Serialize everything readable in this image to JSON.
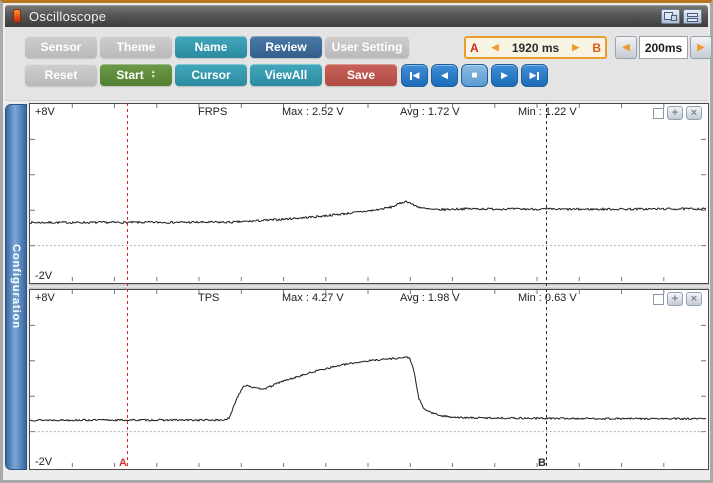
{
  "titlebar": {
    "title": "Oscilloscope",
    "app_icon": "thermometer-icon",
    "right_icons": [
      "tile-windows-icon",
      "stack-windows-icon"
    ]
  },
  "toolbar": {
    "row1": [
      {
        "label": "Sensor",
        "variant": "gray"
      },
      {
        "label": "Theme",
        "variant": "gray"
      },
      {
        "label": "Name",
        "variant": "teal"
      },
      {
        "label": "Review",
        "variant": "blue"
      },
      {
        "label": "User Setting",
        "variant": "gray"
      }
    ],
    "row2": [
      {
        "label": "Reset",
        "variant": "gray"
      },
      {
        "label": "Start",
        "variant": "green",
        "spinner_up": "▲",
        "spinner_down": "▼"
      },
      {
        "label": "Cursor",
        "variant": "teal"
      },
      {
        "label": "ViewAll",
        "variant": "teal"
      },
      {
        "label": "Save",
        "variant": "red"
      }
    ],
    "ab_box": {
      "a_label": "A",
      "left_arrow": "◀",
      "value": "1920 ms",
      "right_arrow": "▶",
      "b_label": "B"
    },
    "interval": {
      "left_arrow": "◀",
      "value": "200ms",
      "right_arrow": "▶"
    },
    "playback": {
      "skip_start_glyph": "◀",
      "step_back_glyph": "◀",
      "stop_glyph": "■",
      "play_glyph": "▶",
      "skip_end_glyph": "▶"
    }
  },
  "sidebar": {
    "label": "Configuration"
  },
  "panels": [
    {
      "channel": "FRPS",
      "top_label": "+8V",
      "bottom_label": "-2V",
      "max": "Max : 2.52 V",
      "avg": "Avg : 1.72 V",
      "min": "Min : 1.22 V",
      "controls": {
        "plus": "+",
        "close": "×"
      }
    },
    {
      "channel": "TPS",
      "top_label": "+8V",
      "bottom_label": "-2V",
      "max": "Max : 4.27 V",
      "avg": "Avg : 1.98 V",
      "min": "Min : 0.63 V",
      "controls": {
        "plus": "+",
        "close": "×"
      }
    }
  ],
  "cursors": {
    "a_label": "A",
    "b_label": "B",
    "a_frac": 0.145,
    "b_frac": 0.762
  },
  "colors": {
    "teal": "#2e96ac",
    "review_blue": "#3a6a99",
    "start_green": "#5c8a38",
    "save_red": "#bb4f46",
    "playback_blue": "#2478c8",
    "stop_active_blue": "#5b9bd0",
    "ab_border_orange": "#eb9c2d",
    "ab_bg_cream": "#f8f4e3",
    "cursor_a_red": "#e02020",
    "cursor_b_black": "#2a2a2a",
    "config_tab_blue": "#4a7ab5",
    "waveform_black": "#1a1a1a"
  },
  "chart_data": [
    {
      "type": "line",
      "title": "FRPS",
      "ylabel": "V",
      "ylim": [
        -2,
        8
      ],
      "unit": "V",
      "stats": {
        "max": 2.52,
        "avg": 1.72,
        "min": 1.22
      },
      "grid_zero_line_v": 0,
      "noise_v": 0.06,
      "points_frac_v": [
        [
          0,
          1.3
        ],
        [
          0.3,
          1.32
        ],
        [
          0.36,
          1.45
        ],
        [
          0.42,
          1.62
        ],
        [
          0.47,
          1.82
        ],
        [
          0.51,
          2.0
        ],
        [
          0.535,
          2.18
        ],
        [
          0.552,
          2.46
        ],
        [
          0.558,
          2.5
        ],
        [
          0.568,
          2.28
        ],
        [
          0.582,
          2.1
        ],
        [
          0.6,
          2.02
        ],
        [
          0.64,
          2.08
        ],
        [
          0.8,
          2.05
        ],
        [
          1,
          2.08
        ]
      ]
    },
    {
      "type": "line",
      "title": "TPS",
      "ylabel": "V",
      "ylim": [
        -2,
        8
      ],
      "unit": "V",
      "stats": {
        "max": 4.27,
        "avg": 1.98,
        "min": 0.63
      },
      "grid_zero_line_v": 0,
      "noise_v": 0.05,
      "points_frac_v": [
        [
          0,
          0.65
        ],
        [
          0.285,
          0.65
        ],
        [
          0.295,
          0.75
        ],
        [
          0.305,
          1.8
        ],
        [
          0.315,
          2.55
        ],
        [
          0.322,
          2.62
        ],
        [
          0.335,
          2.42
        ],
        [
          0.35,
          2.45
        ],
        [
          0.37,
          2.8
        ],
        [
          0.4,
          3.15
        ],
        [
          0.43,
          3.5
        ],
        [
          0.46,
          3.75
        ],
        [
          0.49,
          3.95
        ],
        [
          0.52,
          4.08
        ],
        [
          0.545,
          4.15
        ],
        [
          0.558,
          4.2
        ],
        [
          0.562,
          4.15
        ],
        [
          0.568,
          3.4
        ],
        [
          0.575,
          1.9
        ],
        [
          0.582,
          1.3
        ],
        [
          0.595,
          1.05
        ],
        [
          0.61,
          0.88
        ],
        [
          0.64,
          0.78
        ],
        [
          0.8,
          0.74
        ],
        [
          1,
          0.72
        ]
      ]
    }
  ]
}
